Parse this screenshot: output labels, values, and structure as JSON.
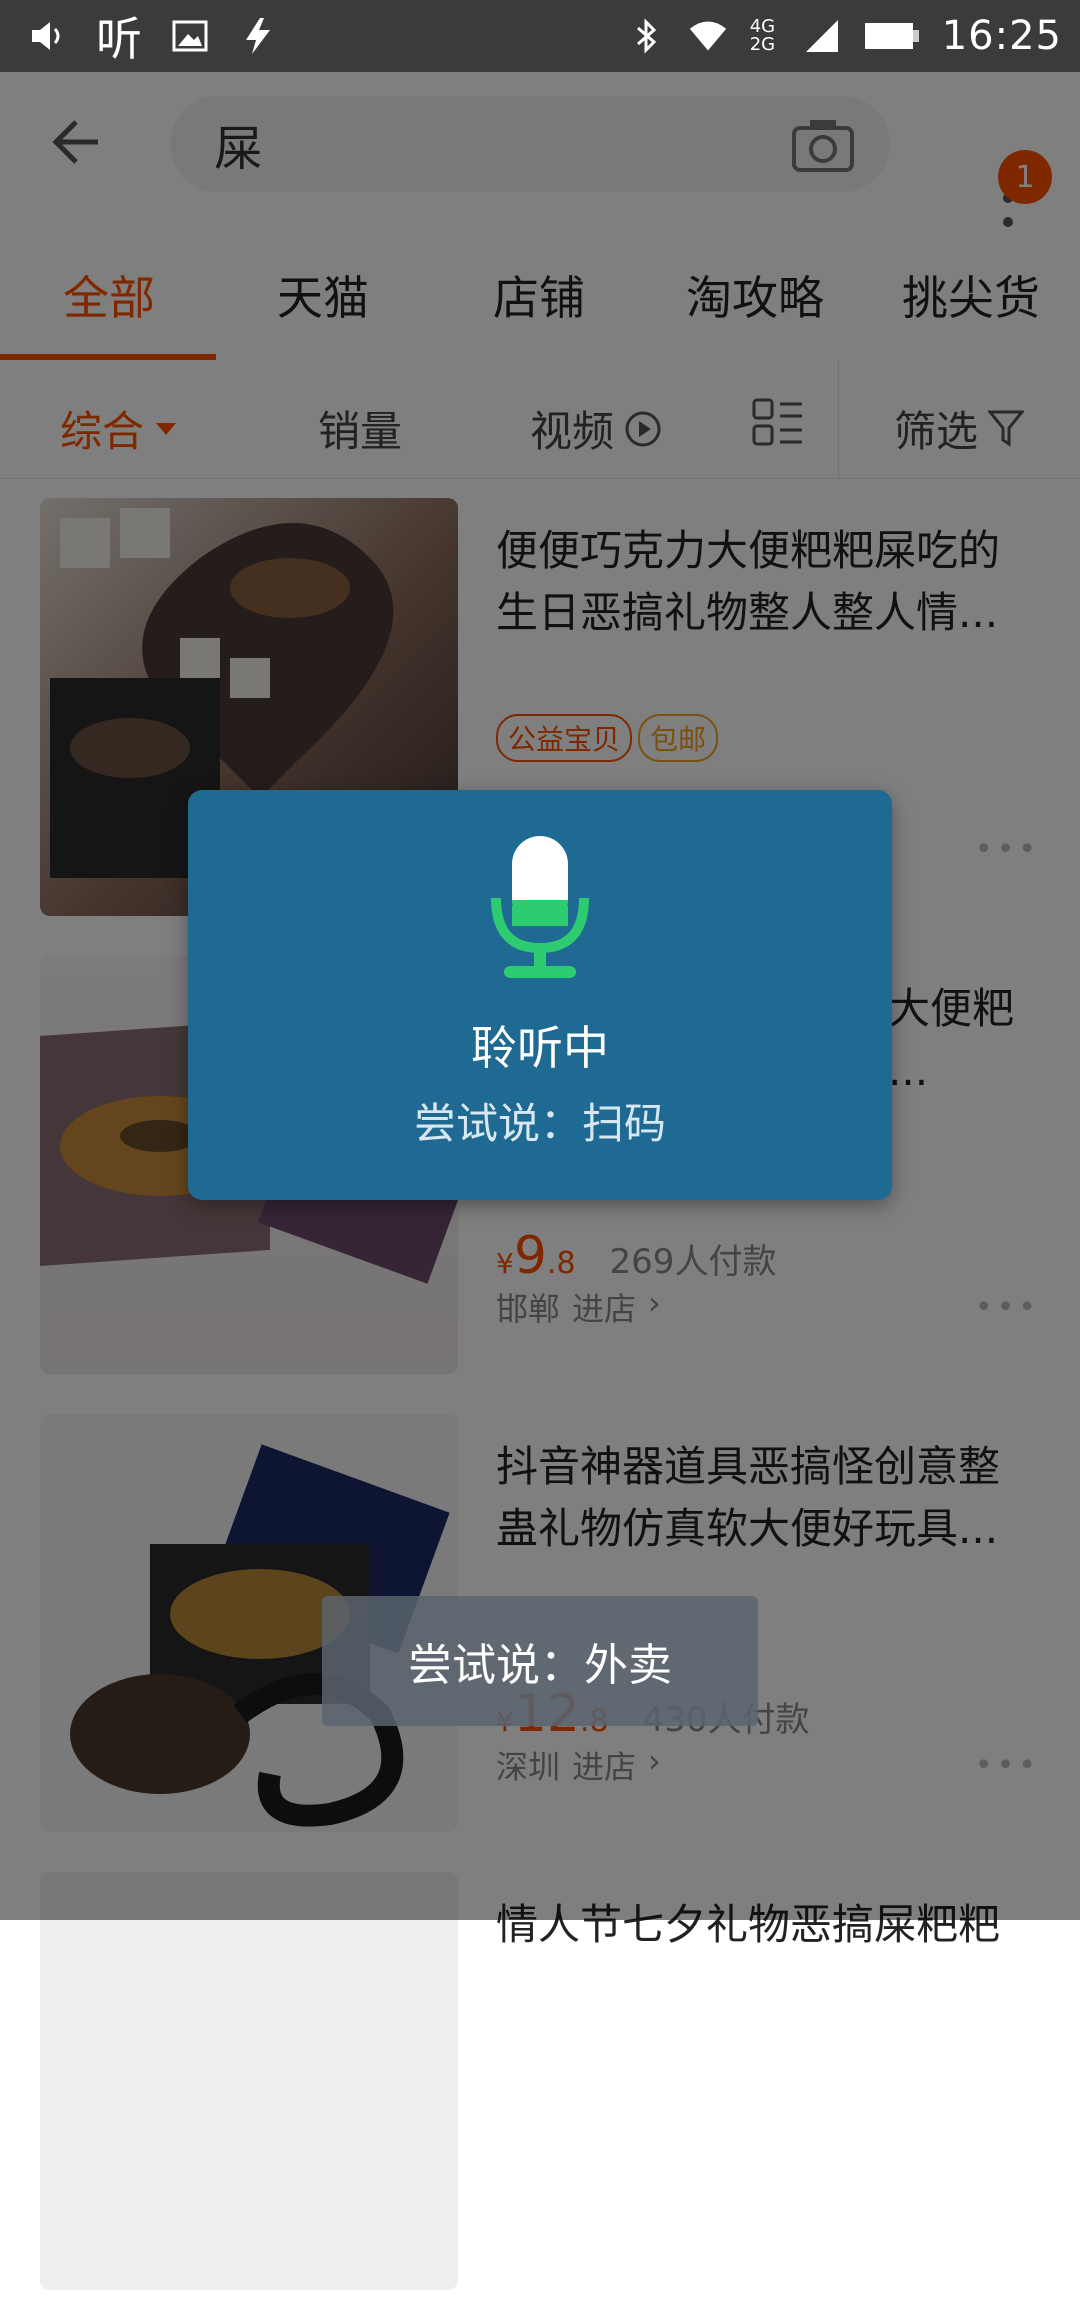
{
  "status_bar": {
    "left_icons": [
      "volume-icon",
      "listen-icon",
      "image-icon",
      "flash-icon"
    ],
    "listen_label": "听",
    "network_label": "4G 2G",
    "time": "16:25"
  },
  "header": {
    "search_value": "屎",
    "badge_count": "1"
  },
  "tabs": [
    {
      "label": "全部"
    },
    {
      "label": "天猫"
    },
    {
      "label": "店铺"
    },
    {
      "label": "淘攻略"
    },
    {
      "label": "挑尖货"
    }
  ],
  "sort": {
    "composite": "综合",
    "sales": "销量",
    "video": "视频",
    "filter": "筛选"
  },
  "products": [
    {
      "title": "便便巧克力大便粑粑屎吃的生日恶搞礼物整人整人情...",
      "tags": [
        "公益宝贝",
        "包邮"
      ],
      "price_int": "",
      "price_dec": "",
      "sales": "",
      "shop": ""
    },
    {
      "title": "世大便粑粑...",
      "tags": [],
      "price_int": "9",
      "price_dec": ".8",
      "sales": "269人付款",
      "shop": "邯郸",
      "visit": "进店"
    },
    {
      "title": "抖音神器道具恶搞怪创意整蛊礼物仿真软大便好玩具...",
      "tags": [],
      "price_int": "12",
      "price_dec": ".8",
      "sales": "430人付款",
      "shop": "深圳",
      "visit": "进店"
    },
    {
      "title": "情人节七夕礼物恶搞屎粑粑"
    }
  ],
  "voice_dialog": {
    "status": "聆听中",
    "hint": "尝试说：扫码"
  },
  "toast": {
    "text": "尝试说：外卖"
  },
  "colors": {
    "accent": "#ff5000",
    "dialog_bg": "#1f6a92",
    "mic_green": "#2ecc71"
  }
}
